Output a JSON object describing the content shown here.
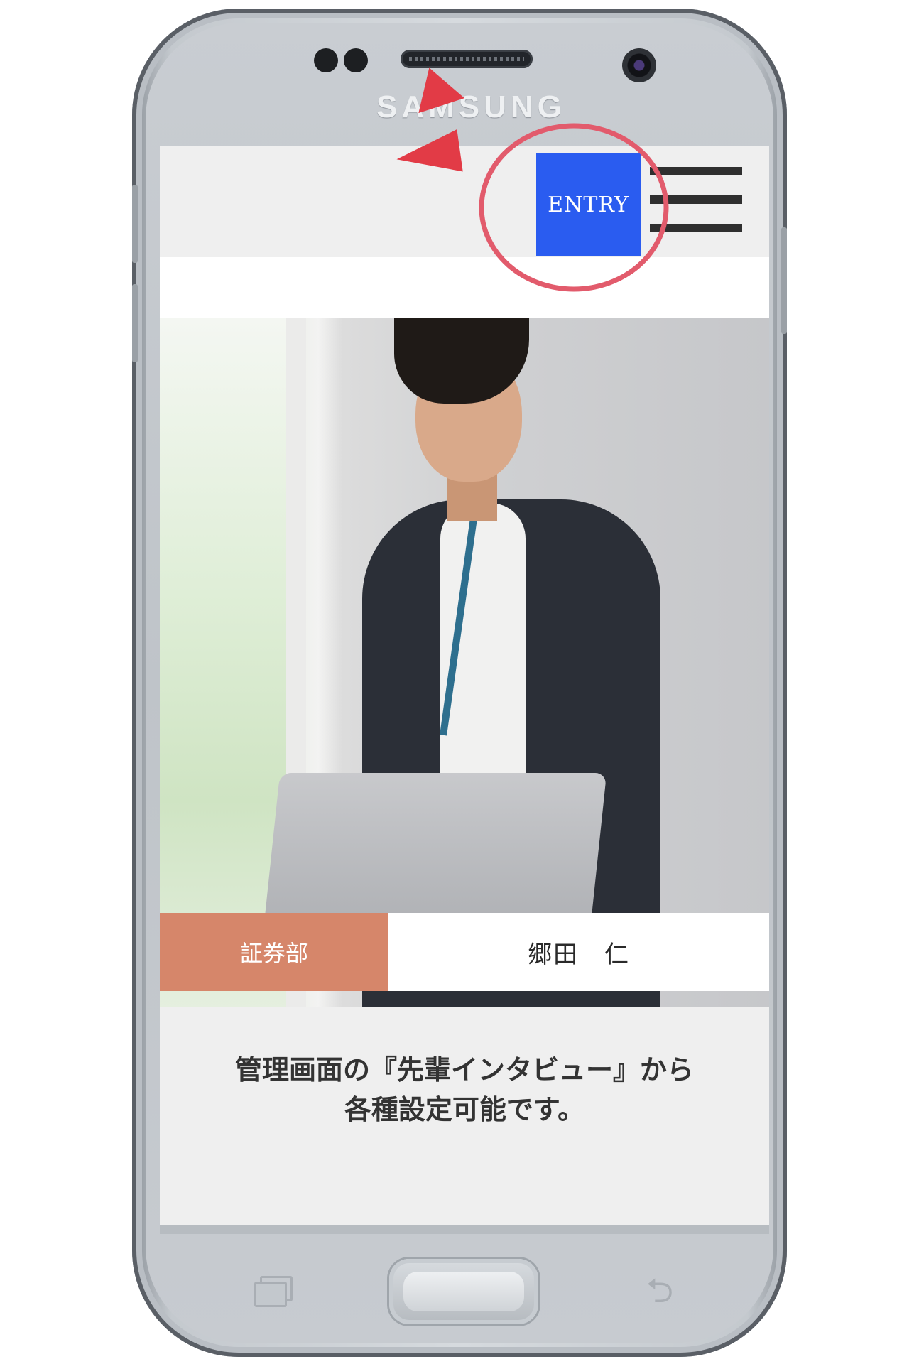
{
  "device": {
    "brand": "SAMSUNG"
  },
  "header": {
    "entry_label": "ENTRY",
    "menu_icon": "hamburger-menu-icon",
    "highlight_color": "#e25b6c",
    "arrow_color": "#e23b46"
  },
  "interview": {
    "department": "証券部",
    "name": "郷田　仁",
    "department_color": "#d6866a"
  },
  "content": {
    "line1": "管理画面の『先輩インタビュー』から",
    "line2": "各種設定可能です。"
  },
  "nav": {
    "recent_icon": "recent-apps-icon",
    "home_icon": "home-button",
    "back_icon": "back-icon"
  },
  "colors": {
    "entry_button": "#2a5cf0",
    "header_bg": "#efefef",
    "content_bg": "#efefef"
  }
}
